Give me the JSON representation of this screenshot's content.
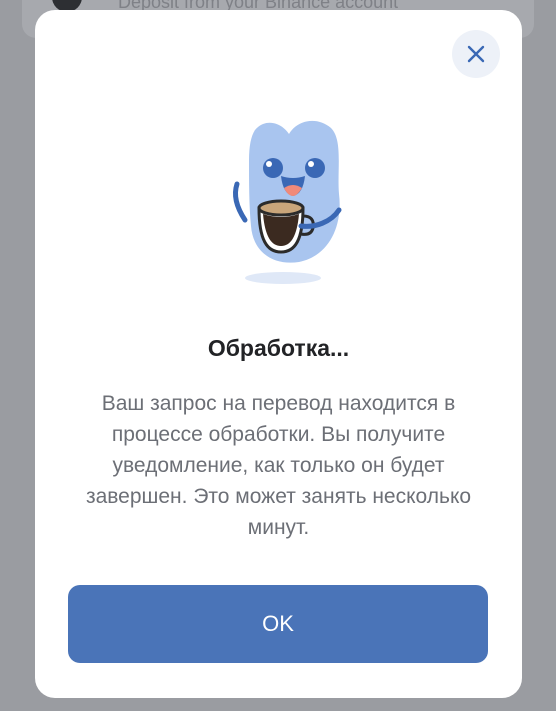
{
  "background": {
    "list_item_text": "Deposit from your Binance account"
  },
  "modal": {
    "close_icon": "close-icon",
    "illustration": "mascot-with-coffee-cup",
    "title": "Обработка...",
    "description": "Ваш запрос на перевод находится в процессе обработки. Вы получите уведомление, как только он будет завершен. Это может занять несколько минут.",
    "ok_label": "OK",
    "colors": {
      "primary_button": "#4a74b8",
      "close_button_bg": "#edf1f8",
      "mascot_body": "#a9c5ef"
    }
  }
}
